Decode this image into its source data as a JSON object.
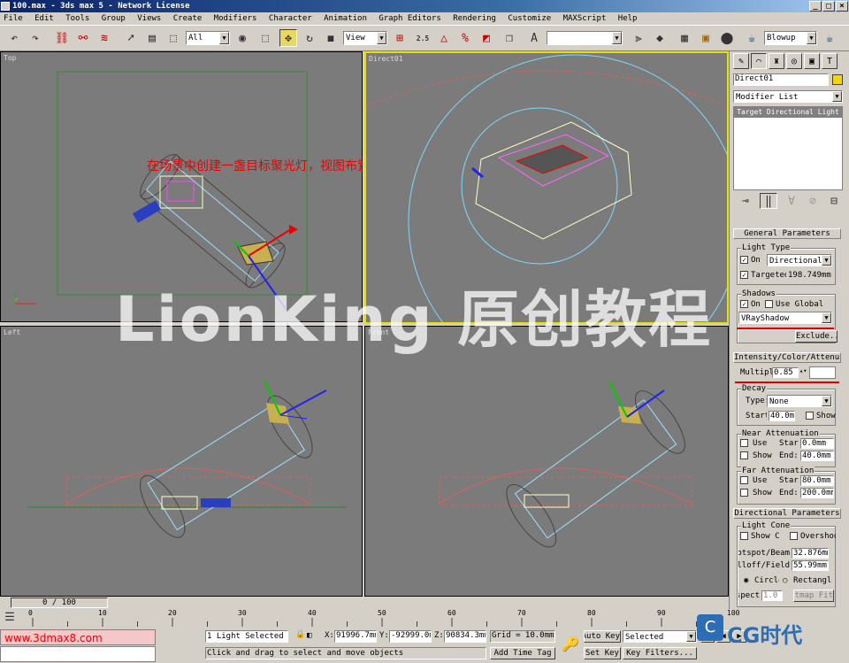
{
  "window": {
    "title": "100.max - 3ds max 5 - Network License",
    "min": "_",
    "max": "□",
    "close": "×"
  },
  "menu": [
    "File",
    "Edit",
    "Tools",
    "Group",
    "Views",
    "Create",
    "Modifiers",
    "Character",
    "Animation",
    "Graph Editors",
    "Rendering",
    "Customize",
    "MAXScript",
    "Help"
  ],
  "toolbar": {
    "selection_filter": "All",
    "ref_coord": "View",
    "render_type": "Blowup",
    "angle_snap": "2.5"
  },
  "viewports": {
    "top": "Top",
    "direct": "Direct01",
    "left": "Left",
    "front": "Front"
  },
  "overlay": {
    "instruction": "在场景中创建一盏目标聚光灯，视图布置如图：",
    "watermark": "LionKing 原创教程"
  },
  "command_panel": {
    "object_name": "Direct01",
    "object_color": "#f0d800",
    "modifier_list": "Modifier List",
    "stack_item": "Target Directional Light",
    "general": {
      "header": "General Parameters",
      "light_type_group": "Light Type",
      "on_label": "On",
      "on_checked": "✓",
      "light_type": "Directional",
      "target_label": "Targeted:",
      "target_checked": "✓",
      "target_value": "198.749mm",
      "shadows_group": "Shadows",
      "shadows_on_label": "On",
      "shadows_on_checked": "✓",
      "use_global_label": "Use Global",
      "shadow_type": "VRayShadow",
      "exclude": "Exclude..."
    },
    "intensity": {
      "header": "Intensity/Color/Attenuation",
      "multiplier_label": "Multiplier:",
      "multiplier": "0.85",
      "decay_group": "Decay",
      "type_label": "Type:",
      "decay_type": "None",
      "start_label": "Start:",
      "decay_start": "40.0mm",
      "show_label": "Show",
      "near_group": "Near Attenuation",
      "near_use": "Use",
      "near_start_label": "Start:",
      "near_start": "0.0mm",
      "near_show": "Show",
      "near_end_label": "End:",
      "near_end": "40.0mm",
      "far_group": "Far Attenuation",
      "far_use": "Use",
      "far_start_label": "Start:",
      "far_start": "80.0mm",
      "far_show": "Show",
      "far_end_label": "End:",
      "far_end": "200.0mm"
    },
    "directional": {
      "header": "Directional Parameters",
      "cone_group": "Light Cone",
      "show_cone": "Show Cone",
      "overshoot": "Overshoot",
      "hotspot_label": "Hotspot/Beam:",
      "hotspot": "32.876mm",
      "falloff_label": "Falloff/Field:",
      "falloff": "55.99mm",
      "circle": "Circle",
      "rectangle": "Rectangle",
      "aspect_label": "Aspect:",
      "aspect": "1.0",
      "bitmap_fit": "Bitmap Fit..."
    }
  },
  "timeline": {
    "frame": "0 / 100",
    "ticks": [
      "0",
      "10",
      "20",
      "30",
      "40",
      "50",
      "60",
      "70",
      "80",
      "90",
      "100"
    ]
  },
  "status": {
    "selected": "1 Light Selected",
    "prompt": "Click and drag to select and move objects",
    "x_label": "X:",
    "x": "91996.7mm",
    "y_label": "Y:",
    "y": "-92999.0mm",
    "z_label": "Z:",
    "z": "90834.3mm",
    "grid": "Grid = 10.0mm",
    "add_time_tag": "Add Time Tag",
    "auto_key": "Auto Key",
    "set_key": "Set Key",
    "key_mode": "Selected",
    "key_filters": "Key Filters...",
    "site": "www.3dmax8.com",
    "logo": "CG时代"
  }
}
